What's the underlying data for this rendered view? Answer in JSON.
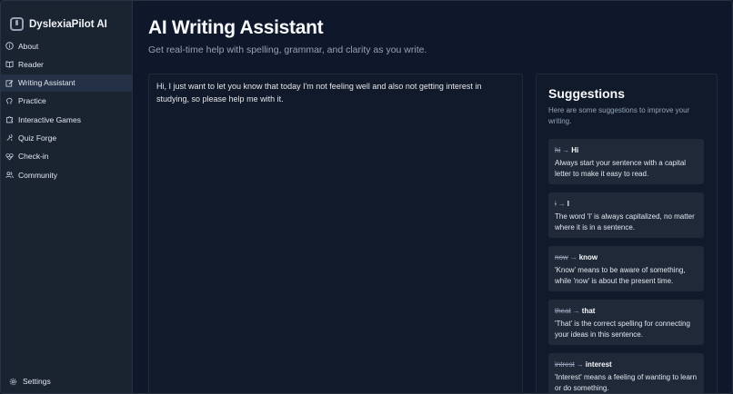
{
  "app": {
    "name": "DyslexiaPilot AI"
  },
  "sidebar": {
    "items": [
      {
        "label": "About",
        "icon": "info-icon"
      },
      {
        "label": "Reader",
        "icon": "book-icon"
      },
      {
        "label": "Writing Assistant",
        "icon": "pencil-icon",
        "active": true
      },
      {
        "label": "Practice",
        "icon": "brain-icon"
      },
      {
        "label": "Interactive Games",
        "icon": "puzzle-icon"
      },
      {
        "label": "Quiz Forge",
        "icon": "quiz-icon"
      },
      {
        "label": "Check-in",
        "icon": "heart-icon"
      },
      {
        "label": "Community",
        "icon": "users-icon"
      }
    ],
    "settings_label": "Settings"
  },
  "header": {
    "title": "AI Writing Assistant",
    "subtitle": "Get real-time help with spelling, grammar, and clarity as you write."
  },
  "editor": {
    "value": "Hi, I just want to let you know that today I'm not feeling well and also not getting interest in studying, so please help me with it."
  },
  "suggestions": {
    "title": "Suggestions",
    "description": "Here are some suggestions to improve your writing.",
    "items": [
      {
        "original": "hi",
        "corrected": "Hi",
        "explanation": "Always start your sentence with a capital letter to make it easy to read."
      },
      {
        "original": "i",
        "corrected": "I",
        "explanation": "The word 'I' is always capitalized, no matter where it is in a sentence."
      },
      {
        "original": "now",
        "corrected": "know",
        "explanation": "'Know' means to be aware of something, while 'now' is about the present time."
      },
      {
        "original": "theat",
        "corrected": "that",
        "explanation": "'That' is the correct spelling for connecting your ideas in this sentence."
      },
      {
        "original": "intrest",
        "corrected": "interest",
        "explanation": "'Interest' means a feeling of wanting to learn or do something."
      }
    ]
  },
  "colors": {
    "background": "#0f172a",
    "sidebar": "#1a2330",
    "card": "#1f2937",
    "active": "#243045"
  }
}
